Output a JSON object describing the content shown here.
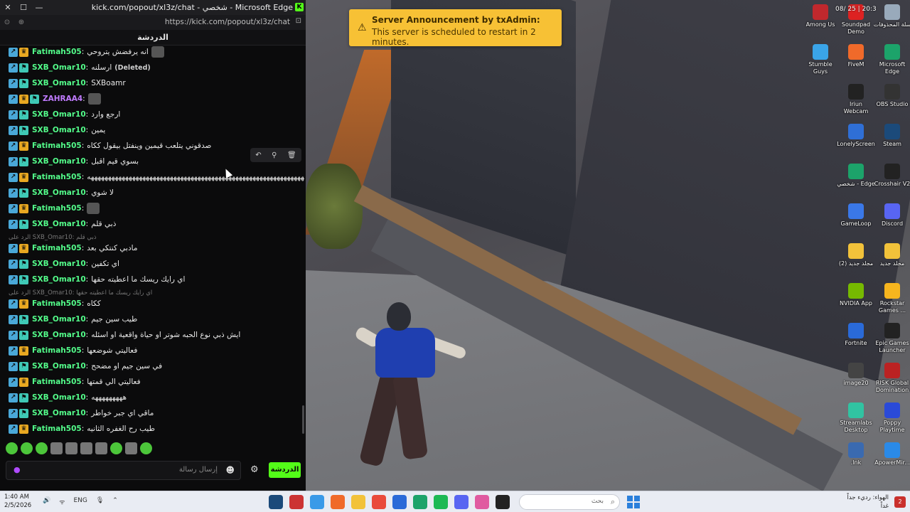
{
  "browser": {
    "title": "kick.com/popout/xl3z/chat - شخصي - Microsoft Edge",
    "url": "https://kick.com/popout/xl3z/chat",
    "chat_header": "الدردشة"
  },
  "announcement": {
    "title": "Server Announcement by txAdmin:",
    "text": "This server is scheduled to restart in 2 minutes."
  },
  "chat": {
    "messages": [
      {
        "user": "Fatimah505",
        "text": "انه يرفضش يتروحي",
        "badge": "crown",
        "emote": true
      },
      {
        "user": "SXB_Omar10",
        "text": "ارسلنه",
        "badge": "sub",
        "deleted": "(Deleted)"
      },
      {
        "user": "SXB_Omar10",
        "text": "SXBoamr",
        "badge": "sub"
      },
      {
        "user": "ZAHRAA4",
        "text": "",
        "badge": "crown-sub",
        "emote": true,
        "purple": true
      },
      {
        "user": "SXB_Omar10",
        "text": "ارجع وارد",
        "badge": "sub"
      },
      {
        "user": "SXB_Omar10",
        "text": "يمين",
        "badge": "sub"
      },
      {
        "user": "Fatimah505",
        "text": "صدقوني يتلعب قيمين وينفتل بيقول ككاه",
        "badge": "crown"
      },
      {
        "user": "SXB_Omar10",
        "text": "بسوي قيم اقبل",
        "badge": "sub"
      },
      {
        "user": "Fatimah505",
        "text": "ههههههههههههههههههههههههههههههههههههههههههههههههههههههههههههههههههههههه",
        "badge": "crown"
      },
      {
        "user": "SXB_Omar10",
        "text": "لا شوي",
        "badge": "sub"
      },
      {
        "user": "Fatimah505",
        "text": "",
        "badge": "crown",
        "emote": true
      },
      {
        "user": "SXB_Omar10",
        "text": "ذبي قلم",
        "badge": "sub"
      },
      {
        "user": "Fatimah505",
        "text": "مادبي كنتكي بعد",
        "badge": "crown"
      },
      {
        "user": "SXB_Omar10",
        "text": "اي تكفين",
        "badge": "sub"
      },
      {
        "user": "SXB_Omar10",
        "text": "اي رايك ريسك ما اعطيته حقها",
        "badge": "sub"
      },
      {
        "user": "Fatimah505",
        "text": "ككاه",
        "badge": "crown"
      },
      {
        "user": "SXB_Omar10",
        "text": "طيب سين جيم",
        "badge": "sub"
      },
      {
        "user": "SXB_Omar10",
        "text": "ايش ذبي نوع الحبه شوتر او حياة واقعية او اسئله",
        "badge": "sub"
      },
      {
        "user": "Fatimah505",
        "text": "فعاليتي شوضعها",
        "badge": "crown"
      },
      {
        "user": "SXB_Omar10",
        "text": "في سين جيم او مضحح",
        "badge": "sub"
      },
      {
        "user": "Fatimah505",
        "text": "فعاليتي الي قمتها",
        "badge": "crown"
      },
      {
        "user": "SXB_Omar10",
        "text": "هههههههههه",
        "badge": "sub"
      },
      {
        "user": "SXB_Omar10",
        "text": "ماقي اي جبر خواطر",
        "badge": "sub"
      },
      {
        "user": "Fatimah505",
        "text": "طيب رح الغفره الثانيه",
        "badge": "crown"
      }
    ],
    "replies": [
      "الرد على SXB_Omar10: ذبي قلم",
      "الرد على SXB_Omar10: اي رايك ريسك ما اعطيته حقها"
    ],
    "input_placeholder": "إرسال رسالة",
    "send_label": "الدردشة"
  },
  "desktop": {
    "icons": [
      {
        "label": "Among Us",
        "color": "#c0282d"
      },
      {
        "label": "Soundpad Demo",
        "color": "#d22"
      },
      {
        "label": "سلة المحذوفات",
        "color": "#9ab"
      },
      {
        "label": "Stumble Guys",
        "color": "#3aa4e8"
      },
      {
        "label": "FiveM",
        "color": "#f06a2a"
      },
      {
        "label": "Microsoft Edge",
        "color": "#1ca36a"
      },
      {
        "label": "Iriun Webcam",
        "color": "#222"
      },
      {
        "label": "OBS Studio",
        "color": "#333"
      },
      {
        "label": "LonelyScreen",
        "color": "#2f6fd6"
      },
      {
        "label": "Steam",
        "color": "#1b4a7a"
      },
      {
        "label": "شخصي - Edge",
        "color": "#1ca36a"
      },
      {
        "label": "Crosshair V2",
        "color": "#222"
      },
      {
        "label": "GameLoop",
        "color": "#3a78e8"
      },
      {
        "label": "Discord",
        "color": "#5865f2"
      },
      {
        "label": "مجلد جديد (2)",
        "color": "#f2c23a"
      },
      {
        "label": "مجلد جديد",
        "color": "#f2c23a"
      },
      {
        "label": "NVIDIA App",
        "color": "#76b900"
      },
      {
        "label": "Rockstar Games ...",
        "color": "#f6b51e"
      },
      {
        "label": "Fortnite",
        "color": "#2a6ad8"
      },
      {
        "label": "Epic Games Launcher",
        "color": "#222"
      },
      {
        "label": "image20",
        "color": "#444"
      },
      {
        "label": "RISK Global Domination",
        "color": "#b22"
      },
      {
        "label": "Streamlabs Desktop",
        "color": "#31c3a2"
      },
      {
        "label": "Poppy Playtime",
        "color": "#2a4ad8"
      },
      {
        "label": ".lnk",
        "color": "#3a6ab0"
      },
      {
        "label": "ApowerMir...",
        "color": "#2a8ae8"
      }
    ],
    "overlay_date": "08/   25 | 20:3"
  },
  "taskbar": {
    "time": "1:40 AM",
    "date": "2/5/2026",
    "lang": "ENG",
    "search_placeholder": "بحث",
    "weather_line1": "الهواء: رديء جداً",
    "weather_line2": "غداً",
    "notif_count": "2"
  }
}
